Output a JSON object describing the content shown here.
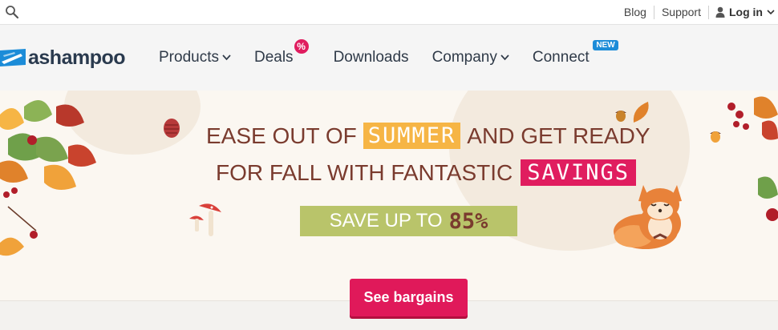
{
  "topbar": {
    "search_icon": "search-icon",
    "links": [
      "Blog",
      "Support"
    ],
    "login_label": "Log in",
    "login_icon": "user-icon"
  },
  "brand": {
    "name": "ashampoo",
    "color": "#1c8cd8"
  },
  "nav": {
    "items": [
      {
        "label": "Products",
        "dropdown": true
      },
      {
        "label": "Deals",
        "badge": "%"
      },
      {
        "label": "Downloads"
      },
      {
        "label": "Company",
        "dropdown": true
      },
      {
        "label": "Connect",
        "badge": "NEW"
      }
    ]
  },
  "hero": {
    "line1_before": "EASE OUT OF",
    "line1_highlight": "SUMMER",
    "line1_after": "AND GET READY",
    "line2_before": "FOR FALL WITH FANTASTIC",
    "line2_highlight": "SAVINGS",
    "save_text": "SAVE UP TO",
    "save_percent": "85%",
    "colors": {
      "text": "#7a3b2e",
      "yellow": "#f6b545",
      "pink": "#e01d5f",
      "green": "#b9c46a"
    }
  },
  "cta": {
    "label": "See bargains",
    "color": "#e0195a"
  }
}
